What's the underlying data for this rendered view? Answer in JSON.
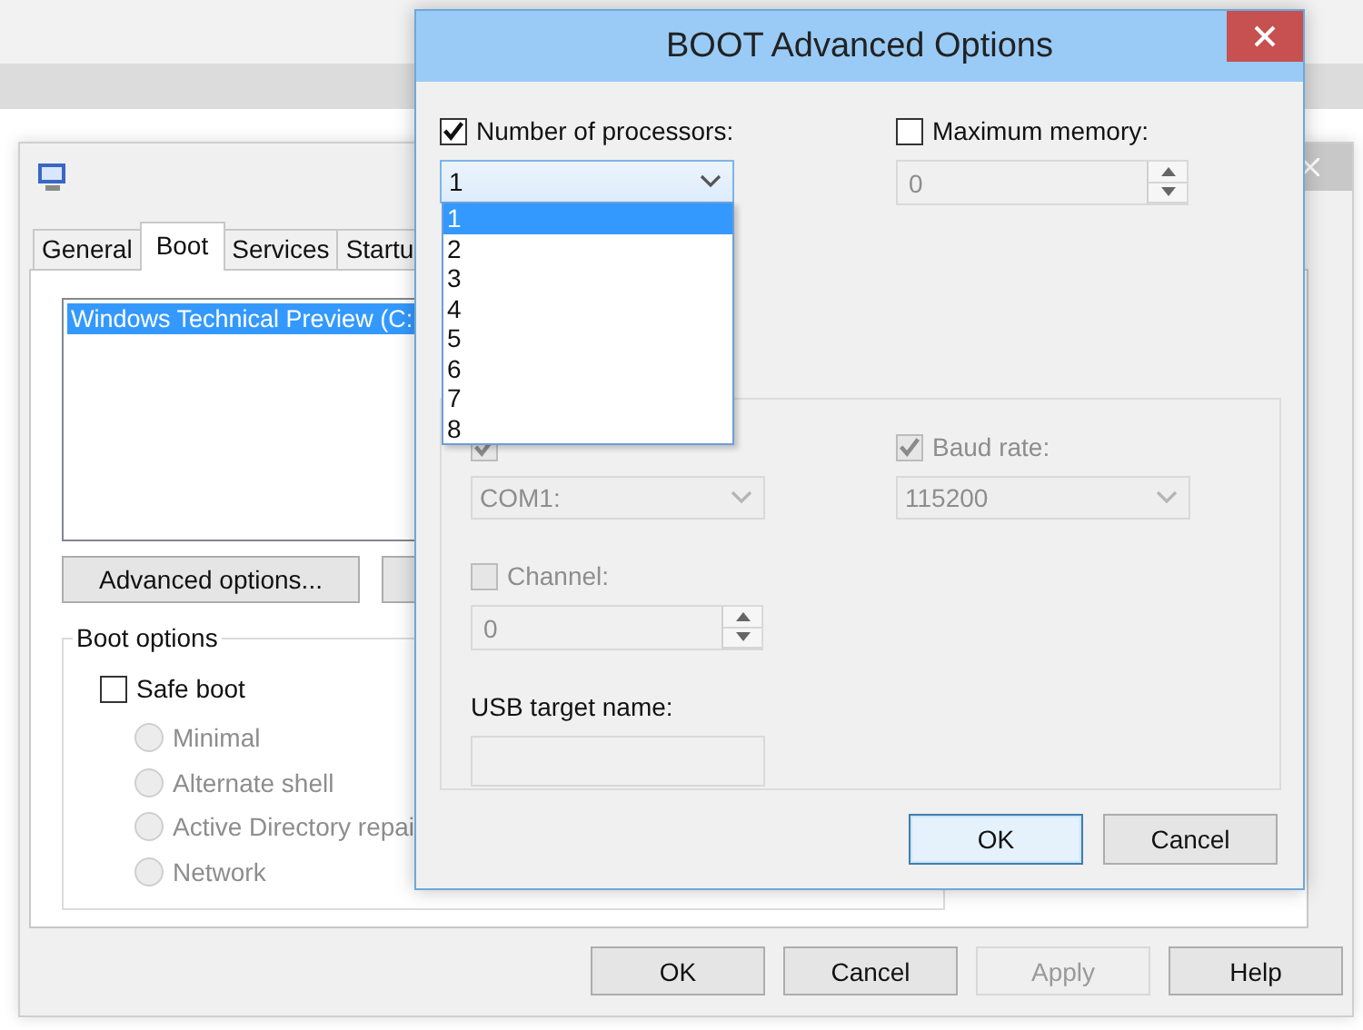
{
  "system_configuration": {
    "tabs": [
      {
        "label": "General",
        "selected": false
      },
      {
        "label": "Boot",
        "selected": true
      },
      {
        "label": "Services",
        "selected": false
      },
      {
        "label": "Startu",
        "selected": false
      }
    ],
    "boot_entries": [
      {
        "label": "Windows Technical Preview (C:",
        "selected": true
      }
    ],
    "advanced_button": "Advanced options...",
    "boot_options": {
      "title": "Boot options",
      "safe_boot": {
        "label": "Safe boot",
        "checked": false
      },
      "modes": [
        {
          "label": "Minimal",
          "selected": false,
          "disabled": true
        },
        {
          "label": "Alternate shell",
          "selected": false,
          "disabled": true
        },
        {
          "label": "Active Directory repai",
          "selected": false,
          "disabled": true
        },
        {
          "label": "Network",
          "selected": false,
          "disabled": true
        }
      ]
    },
    "buttons": [
      {
        "label": "OK",
        "disabled": false
      },
      {
        "label": "Cancel",
        "disabled": false
      },
      {
        "label": "Apply",
        "disabled": true
      },
      {
        "label": "Help",
        "disabled": false
      }
    ]
  },
  "advanced_options": {
    "title": "BOOT Advanced Options",
    "processors": {
      "label": "Number of processors:",
      "checked": true,
      "value": "1",
      "expanded": true,
      "options": [
        {
          "label": "1",
          "selected": true
        },
        {
          "label": "2",
          "selected": false
        },
        {
          "label": "3",
          "selected": false
        },
        {
          "label": "4",
          "selected": false
        },
        {
          "label": "5",
          "selected": false
        },
        {
          "label": "6",
          "selected": false
        },
        {
          "label": "7",
          "selected": false
        },
        {
          "label": "8",
          "selected": false
        }
      ]
    },
    "max_memory": {
      "label": "Maximum memory:",
      "checked": false,
      "value": "0"
    },
    "debug": {
      "disabled": true,
      "debug_port": {
        "checked": true,
        "value": "COM1:"
      },
      "baud_rate": {
        "label": "Baud rate:",
        "checked": true,
        "value": "115200"
      },
      "channel": {
        "label": "Channel:",
        "checked": false,
        "value": "0"
      },
      "usb_target": {
        "label": "USB target name:"
      }
    },
    "buttons": [
      {
        "label": "OK",
        "default": true
      },
      {
        "label": "Cancel",
        "default": false
      }
    ]
  }
}
